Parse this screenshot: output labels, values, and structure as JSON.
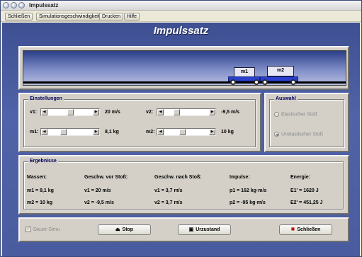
{
  "window": {
    "title": "Impulssatz"
  },
  "menu": [
    "Schließen",
    "Simulationsgeschwindigkeit",
    "Drucken",
    "Hilfe"
  ],
  "app": {
    "heading": "Impulssatz"
  },
  "carts": [
    {
      "label": "m1"
    },
    {
      "label": "m2"
    }
  ],
  "settings": {
    "title": "Einstellungen",
    "v1": {
      "label": "v1:",
      "value": "20 m/s",
      "fraction": 0.5
    },
    "v2": {
      "label": "v2:",
      "value": "-9,5 m/s",
      "fraction": 0.26
    },
    "m1": {
      "label": "m1:",
      "value": "8,1 kg",
      "fraction": 0.32
    },
    "m2": {
      "label": "m2:",
      "value": "10 kg",
      "fraction": 0.4
    }
  },
  "selection": {
    "title": "Auswahl",
    "options": [
      {
        "label": "Elastischer Stoß",
        "checked": false
      },
      {
        "label": "Unelastischer Stoß",
        "checked": true
      }
    ]
  },
  "results": {
    "title": "Ergebnisse",
    "headers": [
      "Massen:",
      "Geschw. vor Stoß:",
      "Geschw. nach Stoß:",
      "Impulse:",
      "Energie:"
    ],
    "rows": [
      [
        "m1 = 8,1 kg",
        "v1 = 20 m/s",
        "v1 = 3,7 m/s",
        "p1 = 162 kg·m/s",
        "E1' = 1620 J"
      ],
      [
        "m2 = 10 kg",
        "v2 = -9,5 m/s",
        "v2 = 3,7 m/s",
        "p2 = -95 kg·m/s",
        "E2' = 451,25 J"
      ]
    ]
  },
  "controls": {
    "dauer_label": "Dauer-Simu",
    "stop_label": "Stop",
    "reset_label": "Urzustand",
    "close_label": "Schließen"
  }
}
